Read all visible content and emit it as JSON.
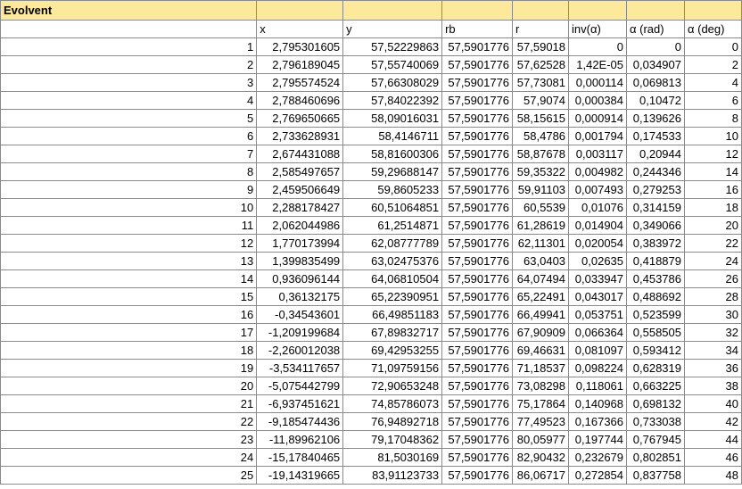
{
  "title": "Evolvent",
  "columns": [
    "x",
    "y",
    "rb",
    "r",
    "inv(α)",
    "α (rad)",
    "α (deg)"
  ],
  "rows": [
    [
      "1",
      "2,795301605",
      "57,52229863",
      "57,5901776",
      "57,59018",
      "0",
      "0",
      "0"
    ],
    [
      "2",
      "2,796189045",
      "57,55740069",
      "57,5901776",
      "57,62528",
      "1,42E-05",
      "0,034907",
      "2"
    ],
    [
      "3",
      "2,795574524",
      "57,66308029",
      "57,5901776",
      "57,73081",
      "0,000114",
      "0,069813",
      "4"
    ],
    [
      "4",
      "2,788460696",
      "57,84022392",
      "57,5901776",
      "57,9074",
      "0,000384",
      "0,10472",
      "6"
    ],
    [
      "5",
      "2,769650665",
      "58,09016031",
      "57,5901776",
      "58,15615",
      "0,000914",
      "0,139626",
      "8"
    ],
    [
      "6",
      "2,733628931",
      "58,4146711",
      "57,5901776",
      "58,4786",
      "0,001794",
      "0,174533",
      "10"
    ],
    [
      "7",
      "2,674431088",
      "58,81600306",
      "57,5901776",
      "58,87678",
      "0,003117",
      "0,20944",
      "12"
    ],
    [
      "8",
      "2,585497657",
      "59,29688147",
      "57,5901776",
      "59,35322",
      "0,004982",
      "0,244346",
      "14"
    ],
    [
      "9",
      "2,459506649",
      "59,8605233",
      "57,5901776",
      "59,91103",
      "0,007493",
      "0,279253",
      "16"
    ],
    [
      "10",
      "2,288178427",
      "60,51064851",
      "57,5901776",
      "60,5539",
      "0,01076",
      "0,314159",
      "18"
    ],
    [
      "11",
      "2,062044986",
      "61,2514871",
      "57,5901776",
      "61,28619",
      "0,014904",
      "0,349066",
      "20"
    ],
    [
      "12",
      "1,770173994",
      "62,08777789",
      "57,5901776",
      "62,11301",
      "0,020054",
      "0,383972",
      "22"
    ],
    [
      "13",
      "1,399835499",
      "63,02475376",
      "57,5901776",
      "63,0403",
      "0,02635",
      "0,418879",
      "24"
    ],
    [
      "14",
      "0,936096144",
      "64,06810504",
      "57,5901776",
      "64,07494",
      "0,033947",
      "0,453786",
      "26"
    ],
    [
      "15",
      "0,36132175",
      "65,22390951",
      "57,5901776",
      "65,22491",
      "0,043017",
      "0,488692",
      "28"
    ],
    [
      "16",
      "-0,34543601",
      "66,49851183",
      "57,5901776",
      "66,49941",
      "0,053751",
      "0,523599",
      "30"
    ],
    [
      "17",
      "-1,209199684",
      "67,89832717",
      "57,5901776",
      "67,90909",
      "0,066364",
      "0,558505",
      "32"
    ],
    [
      "18",
      "-2,260012038",
      "69,42953255",
      "57,5901776",
      "69,46631",
      "0,081097",
      "0,593412",
      "34"
    ],
    [
      "19",
      "-3,534117657",
      "71,09759156",
      "57,5901776",
      "71,18537",
      "0,098224",
      "0,628319",
      "36"
    ],
    [
      "20",
      "-5,075442799",
      "72,90653248",
      "57,5901776",
      "73,08298",
      "0,118061",
      "0,663225",
      "38"
    ],
    [
      "21",
      "-6,937451621",
      "74,85786073",
      "57,5901776",
      "75,17864",
      "0,140968",
      "0,698132",
      "40"
    ],
    [
      "22",
      "-9,185474436",
      "76,94892718",
      "57,5901776",
      "77,49523",
      "0,167366",
      "0,733038",
      "42"
    ],
    [
      "23",
      "-11,89962106",
      "79,17048362",
      "57,5901776",
      "80,05977",
      "0,197744",
      "0,767945",
      "44"
    ],
    [
      "24",
      "-15,17840465",
      "81,5030169",
      "57,5901776",
      "82,90432",
      "0,232679",
      "0,802851",
      "46"
    ],
    [
      "25",
      "-19,14319665",
      "83,91123733",
      "57,5901776",
      "86,06717",
      "0,272854",
      "0,837758",
      "48"
    ]
  ]
}
